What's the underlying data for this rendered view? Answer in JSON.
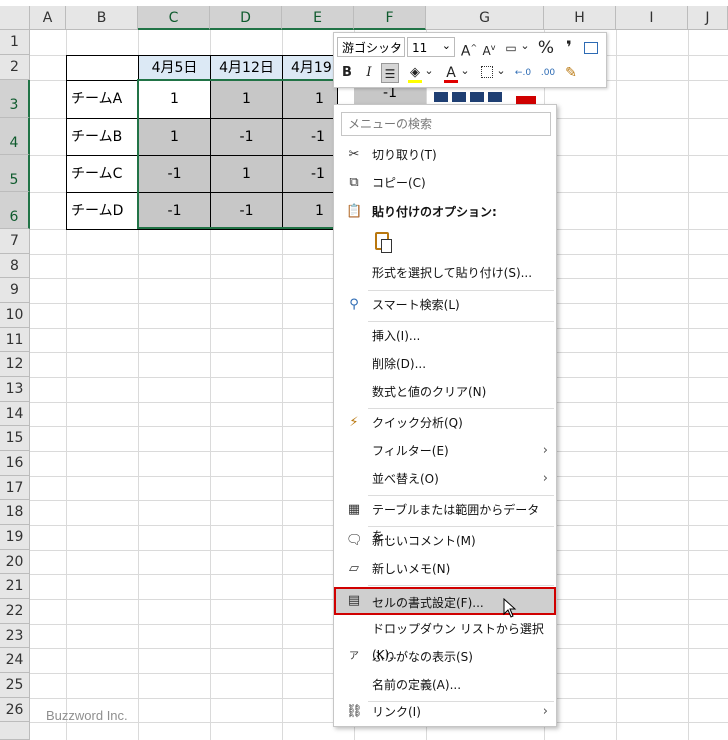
{
  "columns": [
    "A",
    "B",
    "C",
    "D",
    "E",
    "F",
    "G",
    "H",
    "I",
    "J"
  ],
  "rows": [
    "1",
    "2",
    "3",
    "4",
    "5",
    "6",
    "7",
    "8",
    "9",
    "10",
    "11",
    "12",
    "13",
    "14",
    "15",
    "16",
    "17",
    "18",
    "19",
    "20",
    "21",
    "22",
    "23",
    "24",
    "25",
    "26"
  ],
  "table": {
    "dates": [
      "4月5日",
      "4月12日",
      "4月19"
    ],
    "teams": [
      "チームA",
      "チームB",
      "チームC",
      "チームD"
    ],
    "values": [
      [
        "1",
        "1",
        "1",
        "-1"
      ],
      [
        "1",
        "-1",
        "-1",
        ""
      ],
      [
        "-1",
        "1",
        "-1",
        ""
      ],
      [
        "-1",
        "-1",
        "1",
        ""
      ]
    ]
  },
  "mini_toolbar": {
    "font_name": "游ゴシック",
    "font_size": "11",
    "grow_font": "A",
    "shrink_font": "A",
    "percent": "%",
    "comma": "❜",
    "bold": "B",
    "italic": "I",
    "font_color": "A",
    "inc_decimal": "←.0",
    "dec_decimal": ".00",
    "dropdown_caret": "⌄"
  },
  "context_menu": {
    "search_placeholder": "メニューの検索",
    "items": {
      "cut": "切り取り(T)",
      "copy": "コピー(C)",
      "paste_options": "貼り付けのオプション:",
      "paste_special": "形式を選択して貼り付け(S)...",
      "smart_lookup": "スマート検索(L)",
      "insert": "挿入(I)...",
      "delete": "削除(D)...",
      "clear": "数式と値のクリア(N)",
      "quick_analysis": "クイック分析(Q)",
      "filter": "フィルター(E)",
      "sort": "並べ替え(O)",
      "table_from_range": "テーブルまたは範囲からデータを...",
      "new_comment": "新しいコメント(M)",
      "new_note": "新しいメモ(N)",
      "format_cells": "セルの書式設定(F)...",
      "dropdown_pick": "ドロップダウン リストから選択(K)...",
      "phonetic": "ふりがなの表示(S)",
      "define_name": "名前の定義(A)...",
      "link": "リンク(I)"
    },
    "submenu_arrow": "›"
  },
  "watermark": "Buzzword Inc.",
  "colors": {
    "accent": "#217346",
    "highlight_border": "#d00000",
    "selected_cell": "#c7c7c7"
  }
}
